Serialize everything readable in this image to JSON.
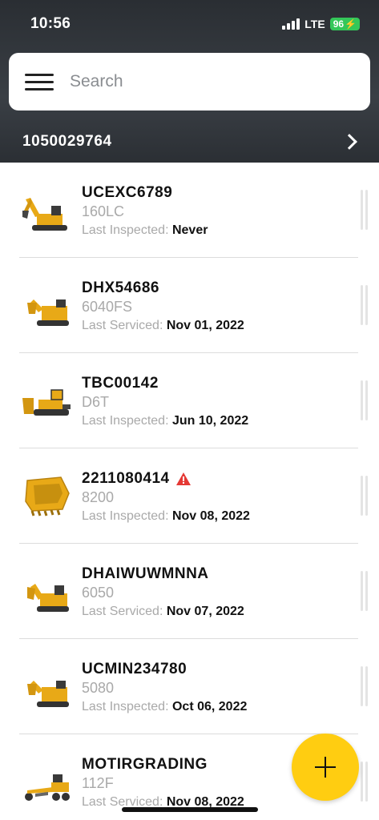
{
  "status_bar": {
    "time": "10:56",
    "network": "LTE",
    "battery": "96"
  },
  "search": {
    "placeholder": "Search"
  },
  "account": {
    "number": "1050029764"
  },
  "colors": {
    "accent": "#ffcd11",
    "header_bg": "#33373c",
    "warning": "#e53935"
  },
  "assets": [
    {
      "id": "UCEXC6789",
      "model": "160LC",
      "label": "Last Inspected:",
      "date": "Never",
      "icon": "excavator-icon",
      "warning": false
    },
    {
      "id": "DHX54686",
      "model": "6040FS",
      "label": "Last Serviced:",
      "date": "Nov 01, 2022",
      "icon": "mining-shovel-icon",
      "warning": false
    },
    {
      "id": "TBC00142",
      "model": "D6T",
      "label": "Last Inspected:",
      "date": "Jun 10, 2022",
      "icon": "dozer-icon",
      "warning": false
    },
    {
      "id": "2211080414",
      "model": "8200",
      "label": "Last Inspected:",
      "date": "Nov 08, 2022",
      "icon": "bucket-icon",
      "warning": true
    },
    {
      "id": "DHAIWUWMNNA",
      "model": "6050",
      "label": "Last Serviced:",
      "date": "Nov 07, 2022",
      "icon": "excavator-icon",
      "warning": false
    },
    {
      "id": "UCMIN234780",
      "model": "5080",
      "label": "Last Inspected:",
      "date": "Oct 06, 2022",
      "icon": "mining-shovel-icon",
      "warning": false
    },
    {
      "id": "MOTIRGRADING",
      "model": "112F",
      "label": "Last Serviced:",
      "date": "Nov 08, 2022",
      "icon": "motor-grader-icon",
      "warning": false
    }
  ]
}
